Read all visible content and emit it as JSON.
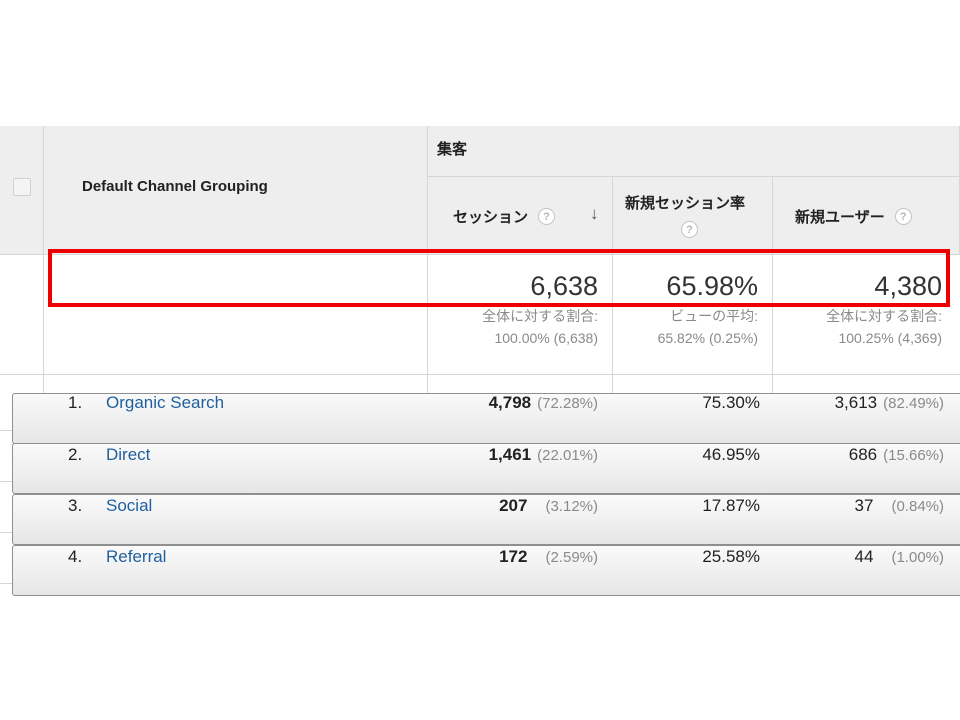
{
  "header": {
    "dimension_label": "Default Channel Grouping",
    "group_label": "集客",
    "columns": [
      {
        "label": "セッション",
        "help": "?",
        "sorted": true
      },
      {
        "label": "新規セッション率",
        "help": "?"
      },
      {
        "label": "新規ユーザー",
        "help": "?"
      }
    ]
  },
  "totals": [
    {
      "value": "6,638",
      "caption": "全体に対する割合:",
      "detail": "100.00% (6,638)"
    },
    {
      "value": "65.98%",
      "caption": "ビューの平均:",
      "detail": "65.82% (0.25%)"
    },
    {
      "value": "4,380",
      "caption": "全体に対する割合:",
      "detail": "100.25% (4,369)"
    }
  ],
  "rows": [
    {
      "index": "1.",
      "channel": "Organic Search",
      "sessions": "4,798",
      "sessions_pct": "(72.28%)",
      "new_session_rate": "75.30%",
      "new_users": "3,613",
      "new_users_pct": "(82.49%)",
      "highlighted": true
    },
    {
      "index": "2.",
      "channel": "Direct",
      "sessions": "1,461",
      "sessions_pct": "(22.01%)",
      "new_session_rate": "46.95%",
      "new_users": "686",
      "new_users_pct": "(15.66%)"
    },
    {
      "index": "3.",
      "channel": "Social",
      "sessions": "207",
      "sessions_pct": "(3.12%)",
      "new_session_rate": "17.87%",
      "new_users": "37",
      "new_users_pct": "(0.84%)"
    },
    {
      "index": "4.",
      "channel": "Referral",
      "sessions": "172",
      "sessions_pct": "(2.59%)",
      "new_session_rate": "25.58%",
      "new_users": "44",
      "new_users_pct": "(1.00%)"
    }
  ],
  "colors": {
    "link": "#1f5f9e",
    "highlight": "#ee0000",
    "header_bg": "#eeeeee"
  }
}
